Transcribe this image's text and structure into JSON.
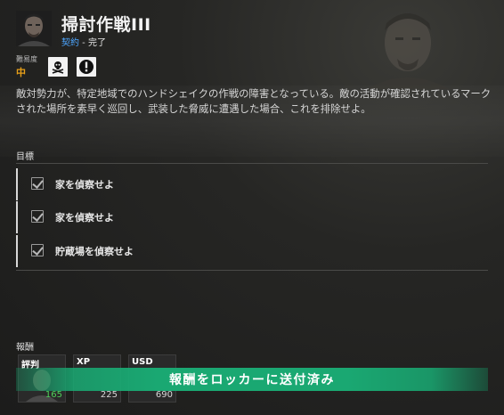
{
  "header": {
    "title": "掃討作戦III",
    "category": "契約",
    "separator": " - ",
    "status": "完了"
  },
  "difficulty": {
    "label": "難易度",
    "value": "中",
    "icons": [
      "skull-crossbones-icon",
      "alert-icon"
    ]
  },
  "description": "敵対勢力が、特定地域でのハンドシェイクの作戦の障害となっている。敵の活動が確認されているマークされた場所を素早く巡回し、武装した脅威に遭遇した場合、これを排除せよ。",
  "objectives": {
    "label": "目標",
    "items": [
      {
        "label": "家を偵察せよ",
        "completed": true
      },
      {
        "label": "家を偵察せよ",
        "completed": true
      },
      {
        "label": "貯蔵場を偵察せよ",
        "completed": true
      }
    ]
  },
  "rewards": {
    "label": "報酬",
    "items": [
      {
        "title": "評判",
        "value": "165",
        "icon": "faction-portrait-icon"
      },
      {
        "title": "XP",
        "value": "225",
        "icon": "xp-icon"
      },
      {
        "title": "USD",
        "value": "690",
        "icon": "usd-icon"
      }
    ]
  },
  "banner": {
    "text": "報酬をロッカーに送付済み"
  },
  "colors": {
    "accent_blue": "#4da6ff",
    "difficulty_orange": "#e8a019",
    "banner_green": "#1aa872",
    "reputation_green": "#4fd05a"
  }
}
